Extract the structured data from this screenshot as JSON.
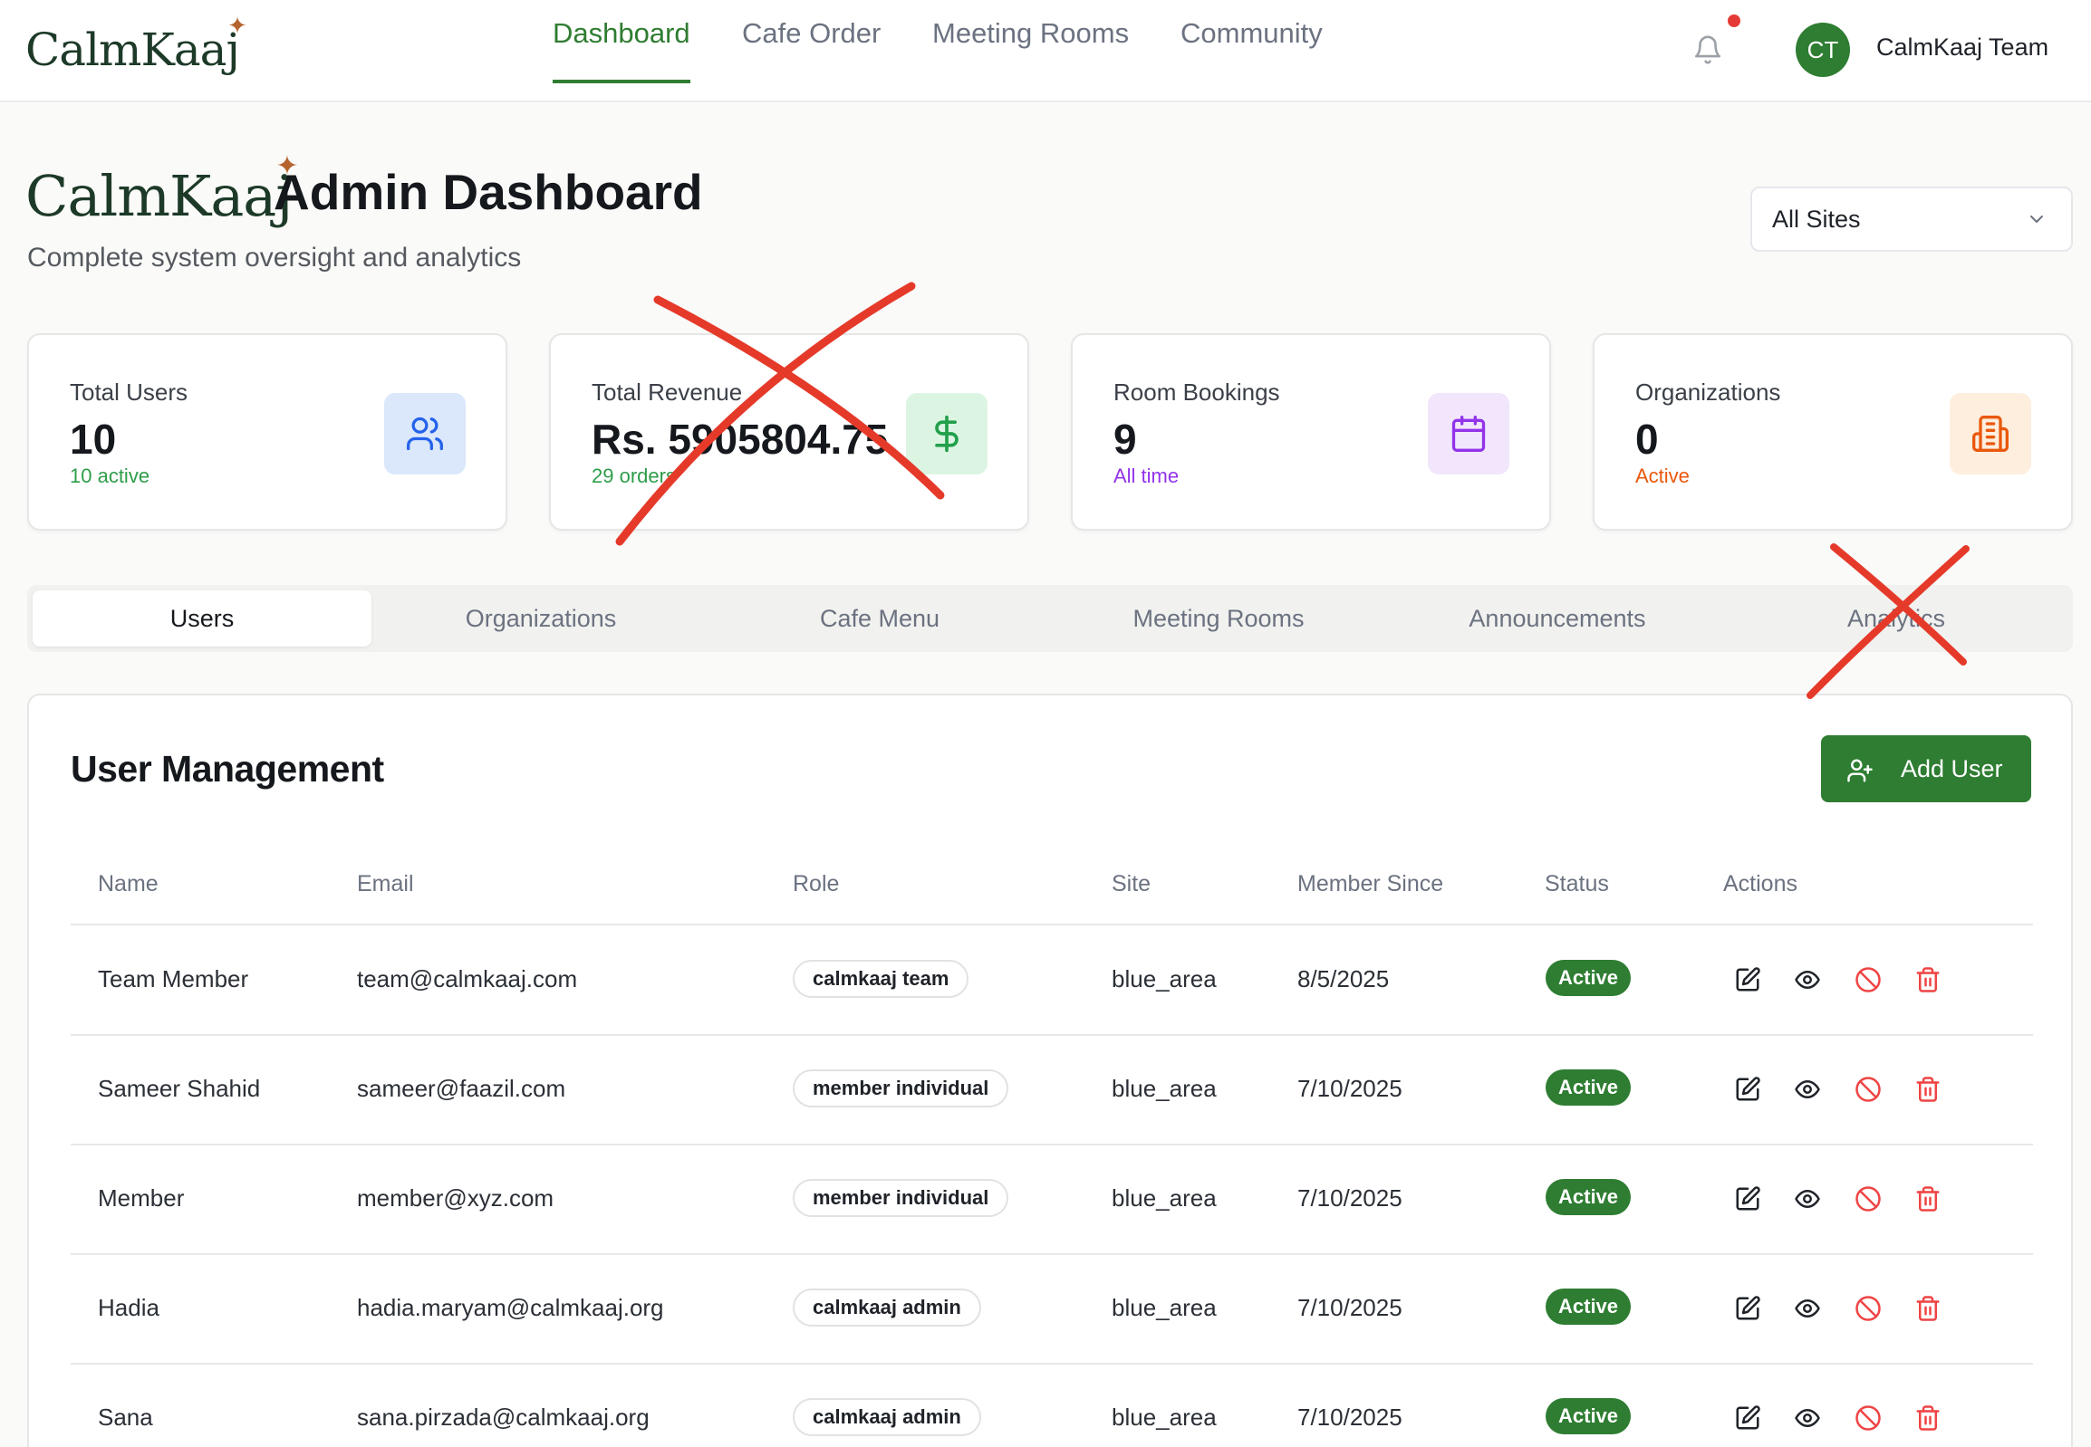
{
  "brand": {
    "logo_text": "CalmKaaj",
    "logo_star": "✦"
  },
  "nav": {
    "items": [
      {
        "label": "Dashboard",
        "active": true
      },
      {
        "label": "Cafe Order",
        "active": false
      },
      {
        "label": "Meeting Rooms",
        "active": false
      },
      {
        "label": "Community",
        "active": false
      }
    ],
    "notification_icon": "bell-icon",
    "avatar_initials": "CT",
    "user_name": "CalmKaaj Team"
  },
  "header": {
    "title": "Admin Dashboard",
    "subtitle": "Complete system oversight and analytics",
    "site_filter": {
      "value": "All Sites",
      "icon": "chevron-down-icon"
    }
  },
  "stats": [
    {
      "label": "Total Users",
      "value": "10",
      "note": "10 active",
      "note_color": "#2e9d4a",
      "icon": "users-icon",
      "icon_bg": "#dbe7fb",
      "icon_color": "#2563eb"
    },
    {
      "label": "Total Revenue",
      "value": "Rs. 5905804.75",
      "note": "29 orders",
      "note_color": "#2e9d4a",
      "icon": "dollar-icon",
      "icon_bg": "#dcf5e3",
      "icon_color": "#22a04b"
    },
    {
      "label": "Room Bookings",
      "value": "9",
      "note": "All time",
      "note_color": "#9333ea",
      "icon": "calendar-icon",
      "icon_bg": "#f1e6fb",
      "icon_color": "#9333ea"
    },
    {
      "label": "Organizations",
      "value": "0",
      "note": "Active",
      "note_color": "#ea580c",
      "icon": "building-icon",
      "icon_bg": "#fdeede",
      "icon_color": "#ea580c"
    }
  ],
  "tabs": [
    {
      "label": "Users",
      "active": true
    },
    {
      "label": "Organizations",
      "active": false
    },
    {
      "label": "Cafe Menu",
      "active": false
    },
    {
      "label": "Meeting Rooms",
      "active": false
    },
    {
      "label": "Announcements",
      "active": false
    },
    {
      "label": "Analytics",
      "active": false
    }
  ],
  "users_panel": {
    "title": "User Management",
    "add_button": "Add User",
    "columns": [
      "Name",
      "Email",
      "Role",
      "Site",
      "Member Since",
      "Status",
      "Actions"
    ],
    "rows": [
      {
        "name": "Team Member",
        "email": "team@calmkaaj.com",
        "role": "calmkaaj team",
        "site": "blue_area",
        "since": "8/5/2025",
        "status": "Active"
      },
      {
        "name": "Sameer Shahid",
        "email": "sameer@faazil.com",
        "role": "member individual",
        "site": "blue_area",
        "since": "7/10/2025",
        "status": "Active"
      },
      {
        "name": "Member",
        "email": "member@xyz.com",
        "role": "member individual",
        "site": "blue_area",
        "since": "7/10/2025",
        "status": "Active"
      },
      {
        "name": "Hadia",
        "email": "hadia.maryam@calmkaaj.org",
        "role": "calmkaaj admin",
        "site": "blue_area",
        "since": "7/10/2025",
        "status": "Active"
      },
      {
        "name": "Sana",
        "email": "sana.pirzada@calmkaaj.org",
        "role": "calmkaaj admin",
        "site": "blue_area",
        "since": "7/10/2025",
        "status": "Active"
      }
    ],
    "action_icons": [
      "edit-icon",
      "eye-icon",
      "ban-icon",
      "trash-icon"
    ]
  },
  "colors": {
    "accent": "#2e7d32",
    "annotation": "#e53a2a"
  }
}
